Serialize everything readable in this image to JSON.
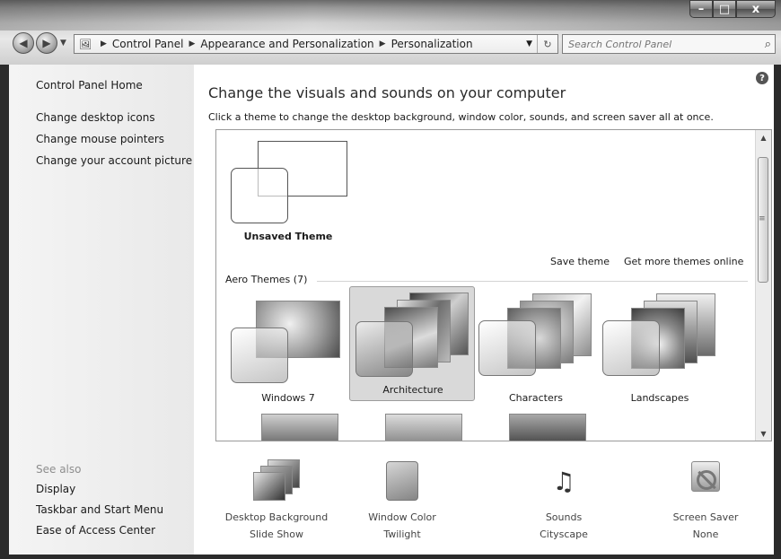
{
  "window": {
    "caption": {
      "minimize": "–",
      "maximize": "□",
      "close": "x"
    }
  },
  "nav": {
    "back_icon": "back-arrow-icon",
    "forward_icon": "forward-arrow-icon",
    "breadcrumbs": [
      "Control Panel",
      "Appearance and Personalization",
      "Personalization"
    ],
    "search_placeholder": "Search Control Panel"
  },
  "sidebar": {
    "home": "Control Panel Home",
    "links": [
      "Change desktop icons",
      "Change mouse pointers",
      "Change your account picture"
    ],
    "see_also_label": "See also",
    "see_also": [
      "Display",
      "Taskbar and Start Menu",
      "Ease of Access Center"
    ]
  },
  "main": {
    "title": "Change the visuals and sounds on your computer",
    "subtitle": "Click a theme to change the desktop background, window color, sounds, and screen saver all at once.",
    "unsaved_theme": "Unsaved Theme",
    "save_theme": "Save theme",
    "get_more": "Get more themes online",
    "aero_section": "Aero Themes (7)",
    "themes": [
      {
        "name": "Windows 7",
        "selected": false
      },
      {
        "name": "Architecture",
        "selected": true
      },
      {
        "name": "Characters",
        "selected": false
      },
      {
        "name": "Landscapes",
        "selected": false
      }
    ]
  },
  "bottom": [
    {
      "title": "Desktop Background",
      "value": "Slide Show",
      "icon": "slideshow-icon"
    },
    {
      "title": "Window Color",
      "value": "Twilight",
      "icon": "window-color-icon"
    },
    {
      "title": "Sounds",
      "value": "Cityscape",
      "icon": "music-notes-icon"
    },
    {
      "title": "Screen Saver",
      "value": "None",
      "icon": "screen-saver-icon"
    }
  ]
}
